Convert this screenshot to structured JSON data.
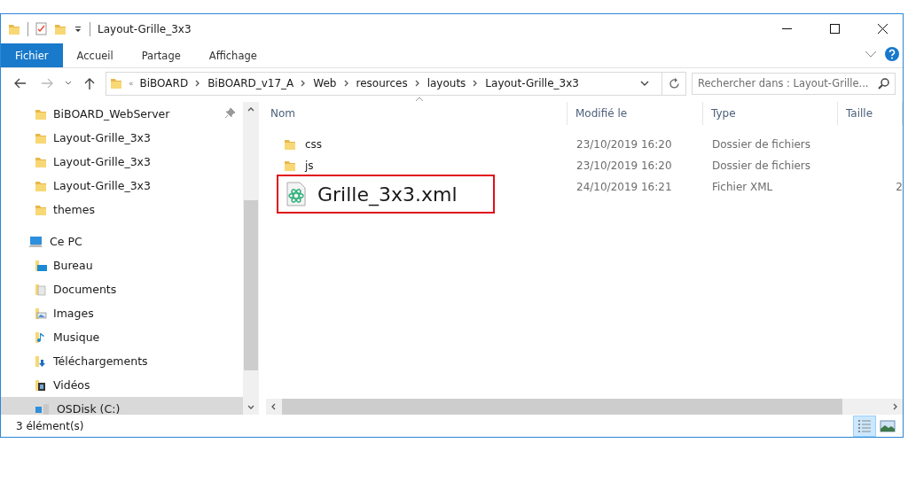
{
  "window": {
    "title": "Layout-Grille_3x3"
  },
  "ribbon_tabs": [
    {
      "label": "Fichier",
      "selected": true
    },
    {
      "label": "Accueil",
      "selected": false
    },
    {
      "label": "Partage",
      "selected": false
    },
    {
      "label": "Affichage",
      "selected": false
    }
  ],
  "address_bar": {
    "overflow": "«",
    "path": [
      "BiBOARD",
      "BiBOARD_v17_A",
      "Web",
      "resources",
      "layouts",
      "Layout-Grille_3x3"
    ]
  },
  "search": {
    "placeholder": "Rechercher dans : Layout-Grille..."
  },
  "sidebar": {
    "items": [
      {
        "label": "BiBOARD_WebServer",
        "kind": "folder",
        "pinned": true,
        "selected": false
      },
      {
        "label": "Layout-Grille_3x3",
        "kind": "folder",
        "pinned": false,
        "selected": false
      },
      {
        "label": "Layout-Grille_3x3",
        "kind": "folder",
        "pinned": false,
        "selected": false
      },
      {
        "label": "Layout-Grille_3x3",
        "kind": "folder",
        "pinned": false,
        "selected": false
      },
      {
        "label": "themes",
        "kind": "folder",
        "pinned": false,
        "selected": false
      },
      {
        "label": "Ce PC",
        "kind": "pc",
        "pinned": false,
        "selected": false
      },
      {
        "label": "Bureau",
        "kind": "desktop",
        "pinned": false,
        "selected": false
      },
      {
        "label": "Documents",
        "kind": "documents",
        "pinned": false,
        "selected": false
      },
      {
        "label": "Images",
        "kind": "images",
        "pinned": false,
        "selected": false
      },
      {
        "label": "Musique",
        "kind": "music",
        "pinned": false,
        "selected": false
      },
      {
        "label": "Téléchargements",
        "kind": "downloads",
        "pinned": false,
        "selected": false
      },
      {
        "label": "Vidéos",
        "kind": "videos",
        "pinned": false,
        "selected": false
      },
      {
        "label": "OSDisk (C:)",
        "kind": "disk",
        "pinned": false,
        "selected": true
      }
    ]
  },
  "table": {
    "columns": [
      "Nom",
      "Modifié le",
      "Type",
      "Taille"
    ],
    "rows": [
      {
        "kind": "folder",
        "name": "css",
        "modified": "23/10/2019 16:20",
        "type": "Dossier de fichiers",
        "highlighted": false
      },
      {
        "kind": "folder",
        "name": "js",
        "modified": "23/10/2019 16:20",
        "type": "Dossier de fichiers",
        "highlighted": false
      },
      {
        "kind": "xml",
        "name": "Grille_3x3.xml",
        "modified": "24/10/2019 16:21",
        "type": "Fichier XML",
        "size": "2",
        "highlighted": true
      }
    ]
  },
  "status_bar": {
    "count": "3 élément(s)",
    "views": [
      {
        "kind": "details",
        "selected": true
      },
      {
        "kind": "thumbnails",
        "selected": false
      }
    ]
  }
}
